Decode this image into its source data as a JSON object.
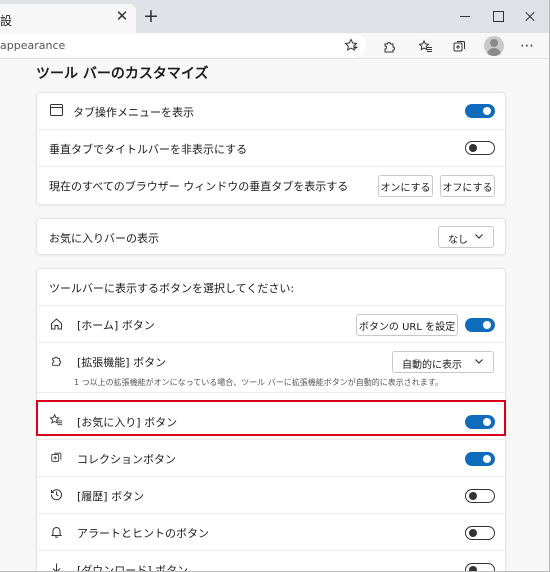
{
  "browser": {
    "tab_title": "設",
    "url": "appearance",
    "icons": [
      "close-icon",
      "plus-icon",
      "star-plus-icon",
      "extensions-icon",
      "favorites-icon",
      "collections-icon",
      "profile-icon",
      "more-icon"
    ]
  },
  "page": {
    "section_title": "ツール バーのカスタマイズ"
  },
  "card1": {
    "tab_actions_label": "タブ操作メニューを表示",
    "tab_actions_on": true,
    "vertical_titlebar_label": "垂直タブでタイトルバーを非表示にする",
    "vertical_titlebar_on": false,
    "vertical_all_label": "現在のすべてのブラウザー ウィンドウの垂直タブを表示する",
    "btn_on": "オンにする",
    "btn_off": "オフにする"
  },
  "card2": {
    "favorites_bar_label": "お気に入りバーの表示",
    "favorites_bar_value": "なし"
  },
  "card3": {
    "header": "ツールバーに表示するボタンを選択してください:",
    "home_label": "[ホーム] ボタン",
    "home_url_button": "ボタンの URL を設定",
    "home_on": true,
    "extensions_label": "[拡張機能] ボタン",
    "extensions_value": "自動的に表示",
    "extensions_note": "1 つ以上の拡張機能がオンになっている場合、ツール バーに拡張機能ボタンが自動的に表示されます。",
    "favorites_label": "[お気に入り] ボタン",
    "favorites_on": true,
    "collections_label": "コレクションボタン",
    "collections_on": true,
    "history_label": "[履歴] ボタン",
    "history_on": false,
    "alerts_label": "アラートとヒントのボタン",
    "alerts_on": false,
    "downloads_label": "[ダウンロード] ボタン",
    "downloads_on": false
  },
  "colors": {
    "toggle_on": "#0f6cbd",
    "highlight": "#d9001b"
  }
}
